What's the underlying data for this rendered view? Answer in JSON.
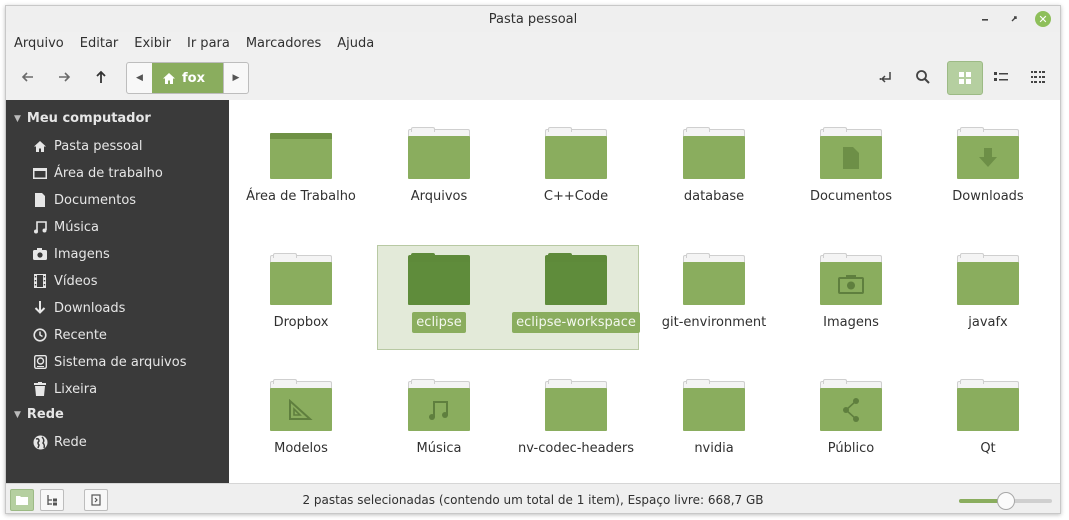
{
  "window": {
    "title": "Pasta pessoal"
  },
  "menubar": [
    "Arquivo",
    "Editar",
    "Exibir",
    "Ir para",
    "Marcadores",
    "Ajuda"
  ],
  "pathbar": {
    "current": "fox"
  },
  "sidebar": {
    "computer_heading": "Meu computador",
    "computer_items": [
      {
        "label": "Pasta pessoal",
        "icon": "home-icon"
      },
      {
        "label": "Área de trabalho",
        "icon": "desktop-icon"
      },
      {
        "label": "Documentos",
        "icon": "document-icon"
      },
      {
        "label": "Música",
        "icon": "music-icon"
      },
      {
        "label": "Imagens",
        "icon": "camera-icon"
      },
      {
        "label": "Vídeos",
        "icon": "film-icon"
      },
      {
        "label": "Downloads",
        "icon": "download-icon"
      },
      {
        "label": "Recente",
        "icon": "clock-icon"
      },
      {
        "label": "Sistema de arquivos",
        "icon": "drive-icon"
      },
      {
        "label": "Lixeira",
        "icon": "trash-icon"
      }
    ],
    "network_heading": "Rede",
    "network_items": [
      {
        "label": "Rede",
        "icon": "globe-icon"
      }
    ]
  },
  "files": [
    {
      "name": "Área de Trabalho",
      "type": "desktop",
      "selected": false
    },
    {
      "name": "Arquivos",
      "type": "folder",
      "selected": false
    },
    {
      "name": "C++Code",
      "type": "folder",
      "selected": false
    },
    {
      "name": "database",
      "type": "folder",
      "selected": false
    },
    {
      "name": "Documentos",
      "type": "documents",
      "selected": false
    },
    {
      "name": "Downloads",
      "type": "downloads",
      "selected": false
    },
    {
      "name": "Dropbox",
      "type": "folder",
      "selected": false
    },
    {
      "name": "eclipse",
      "type": "folder",
      "selected": true
    },
    {
      "name": "eclipse-workspace",
      "type": "folder",
      "selected": true
    },
    {
      "name": "git-environment",
      "type": "folder",
      "selected": false
    },
    {
      "name": "Imagens",
      "type": "pictures",
      "selected": false
    },
    {
      "name": "javafx",
      "type": "folder",
      "selected": false
    },
    {
      "name": "Modelos",
      "type": "templates",
      "selected": false
    },
    {
      "name": "Música",
      "type": "music",
      "selected": false
    },
    {
      "name": "nv-codec-headers",
      "type": "folder",
      "selected": false
    },
    {
      "name": "nvidia",
      "type": "folder",
      "selected": false
    },
    {
      "name": "Público",
      "type": "public",
      "selected": false
    },
    {
      "name": "Qt",
      "type": "folder",
      "selected": false
    }
  ],
  "statusbar": {
    "text": "2 pastas selecionadas (contendo um total de 1 item), Espaço livre: 668,7 GB",
    "zoom_level": 0.5
  },
  "colors": {
    "accent": "#8aad5e",
    "selected_folder": "#5f8c3b",
    "sidebar_bg": "#3a3a3a"
  }
}
